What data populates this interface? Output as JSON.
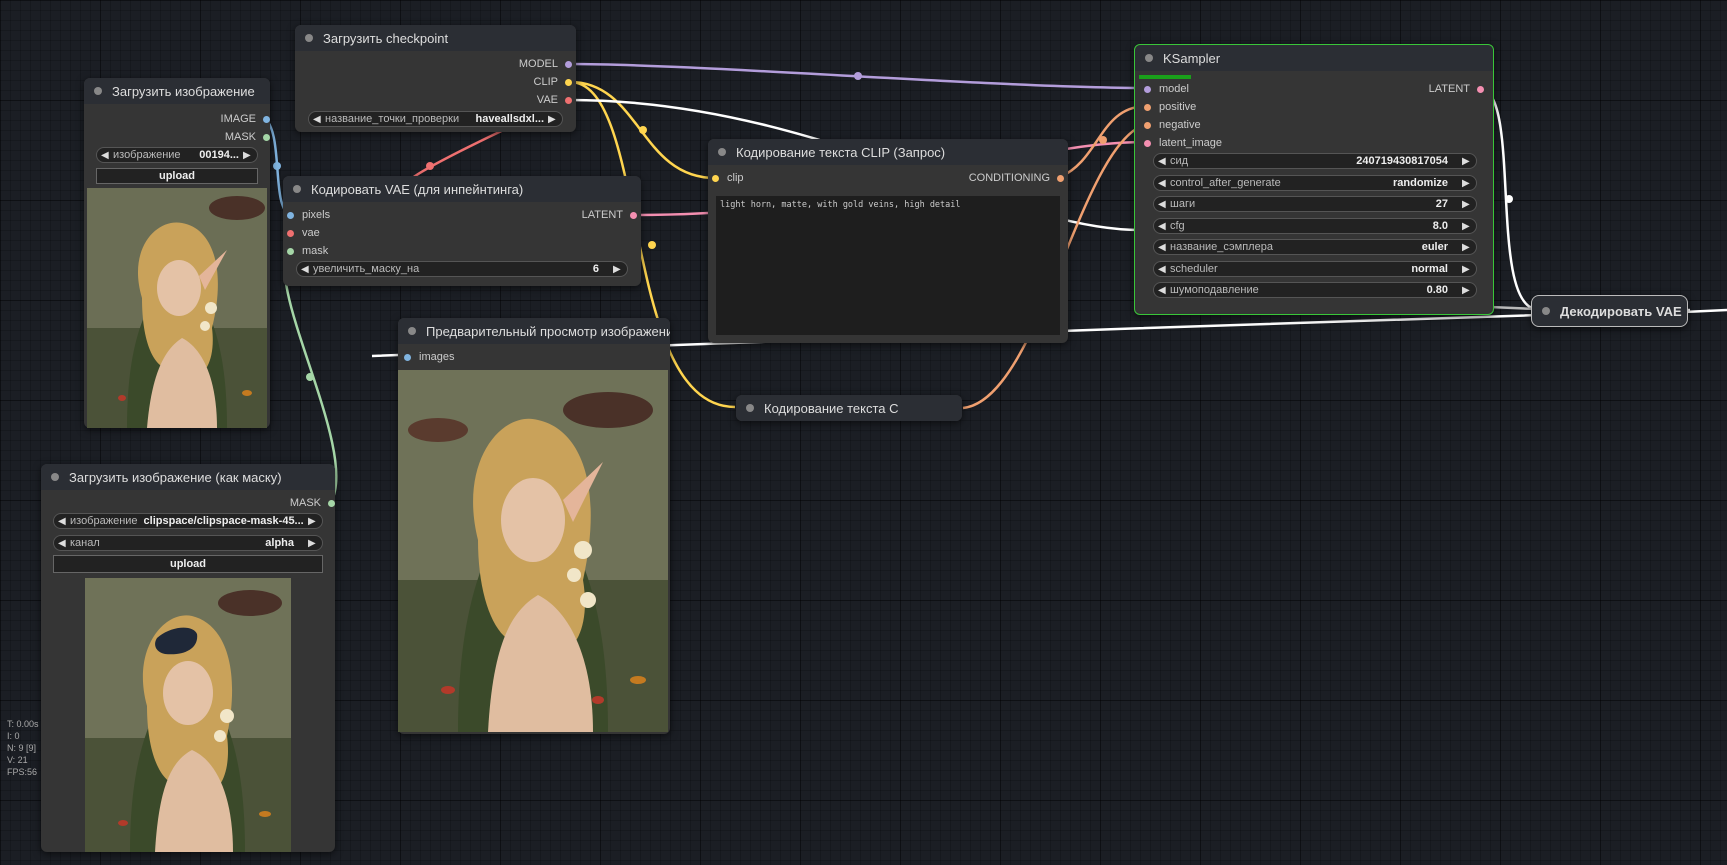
{
  "colors": {
    "model": "#b39ddb",
    "clip": "#ffd54f",
    "vae": "#ef7070",
    "latent": "#f48fb1",
    "image": "#80b4e0",
    "mask": "#a5d6a7",
    "conditioning": "#f0a070",
    "selected": "#39c639"
  },
  "nodes": {
    "load_image": {
      "title": "Загрузить изображение",
      "out_image": "IMAGE",
      "out_mask": "MASK",
      "widget_label": "изображение",
      "widget_value": "00194...",
      "upload": "upload"
    },
    "load_checkpoint": {
      "title": "Загрузить checkpoint",
      "out_model": "MODEL",
      "out_clip": "CLIP",
      "out_vae": "VAE",
      "widget_label": "название_точки_проверки",
      "widget_value": "haveallsdxl..."
    },
    "vae_inpaint": {
      "title": "Кодировать VAE (для инпейнтинга)",
      "in_pixels": "pixels",
      "in_vae": "vae",
      "in_mask": "mask",
      "out_latent": "LATENT",
      "widget_label": "увеличить_маску_на",
      "widget_value": "6"
    },
    "clip_text_pos": {
      "title": "Кодирование текста CLIP (Запрос)",
      "in_clip": "clip",
      "out_conditioning": "CONDITIONING",
      "text": "light horn, matte, with gold veins, high detail"
    },
    "clip_text_neg": {
      "title": "Кодирование текста C"
    },
    "ksampler": {
      "title": "KSampler",
      "in_model": "model",
      "in_positive": "positive",
      "in_negative": "negative",
      "in_latent": "latent_image",
      "out_latent": "LATENT",
      "widgets": [
        {
          "label": "сид",
          "value": "240719430817054"
        },
        {
          "label": "control_after_generate",
          "value": "randomize"
        },
        {
          "label": "шаги",
          "value": "27"
        },
        {
          "label": "cfg",
          "value": "8.0"
        },
        {
          "label": "название_сэмплера",
          "value": "euler"
        },
        {
          "label": "scheduler",
          "value": "normal"
        },
        {
          "label": "шумоподавление",
          "value": "0.80"
        }
      ]
    },
    "preview": {
      "title": "Предварительный просмотр изображения",
      "in_images": "images"
    },
    "load_mask": {
      "title": "Загрузить изображение (как маску)",
      "out_mask": "MASK",
      "widget1_label": "изображение",
      "widget1_value": "clipspace/clipspace-mask-45...",
      "widget2_label": "канал",
      "widget2_value": "alpha",
      "upload": "upload"
    },
    "vae_decode": {
      "title": "Декодировать VAE"
    }
  },
  "stats": {
    "t": "T: 0.00s",
    "i": "I: 0",
    "n": "N: 9 [9]",
    "v": "V: 21",
    "fps": "FPS:56"
  }
}
